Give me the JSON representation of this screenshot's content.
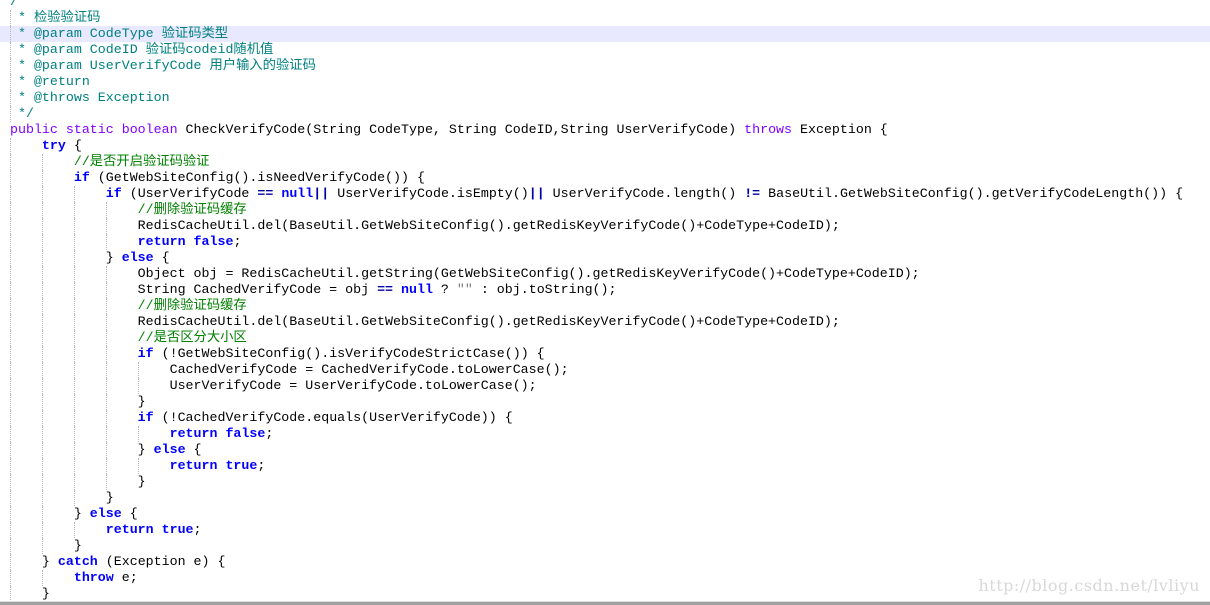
{
  "colors": {
    "javadoc": "#008080",
    "comment": "#008000",
    "keyword": "#0000ff",
    "modifier": "#8000ff",
    "highlight": "#e8e8ff"
  },
  "highlighted_line": 3,
  "watermark": "http://blog.csdn.net/lvliyu",
  "lines": [
    [
      [
        "c",
        "/**"
      ]
    ],
    [
      [
        "c",
        " * 检验验证码"
      ]
    ],
    [
      [
        "c",
        " * @param CodeType 验证码类型"
      ]
    ],
    [
      [
        "c",
        " * @param CodeID 验证码codeid随机值"
      ]
    ],
    [
      [
        "c",
        " * @param UserVerifyCode 用户输入的验证码"
      ]
    ],
    [
      [
        "c",
        " * @return"
      ]
    ],
    [
      [
        "c",
        " * @throws Exception"
      ]
    ],
    [
      [
        "c",
        " */"
      ]
    ],
    [
      [
        "kp",
        "public static boolean"
      ],
      [
        "t",
        " CheckVerifyCode(String CodeType, String CodeID,String UserVerifyCode) "
      ],
      [
        "kp",
        "throws"
      ],
      [
        "t",
        " Exception {"
      ]
    ],
    [
      [
        "t",
        "    "
      ],
      [
        "k",
        "try"
      ],
      [
        "t",
        " {"
      ]
    ],
    [
      [
        "t",
        "        "
      ],
      [
        "cm",
        "//是否开启验证码验证"
      ]
    ],
    [
      [
        "t",
        "        "
      ],
      [
        "k",
        "if"
      ],
      [
        "t",
        " (GetWebSiteConfig().isNeedVerifyCode()) {"
      ]
    ],
    [
      [
        "t",
        "            "
      ],
      [
        "k",
        "if"
      ],
      [
        "t",
        " (UserVerifyCode "
      ],
      [
        "o",
        "=="
      ],
      [
        "t",
        " "
      ],
      [
        "k",
        "null"
      ],
      [
        "o",
        "||"
      ],
      [
        "t",
        " UserVerifyCode.isEmpty()"
      ],
      [
        "o",
        "||"
      ],
      [
        "t",
        " UserVerifyCode.length() "
      ],
      [
        "o",
        "!="
      ],
      [
        "t",
        " BaseUtil.GetWebSiteConfig().getVerifyCodeLength()) {"
      ]
    ],
    [
      [
        "t",
        "                "
      ],
      [
        "cm",
        "//删除验证码缓存"
      ]
    ],
    [
      [
        "t",
        "                RedisCacheUtil.del(BaseUtil.GetWebSiteConfig().getRedisKeyVerifyCode()+CodeType+CodeID);"
      ]
    ],
    [
      [
        "t",
        "                "
      ],
      [
        "k",
        "return false"
      ],
      [
        "t",
        ";"
      ]
    ],
    [
      [
        "t",
        "            } "
      ],
      [
        "k",
        "else"
      ],
      [
        "t",
        " {"
      ]
    ],
    [
      [
        "t",
        "                Object obj = RedisCacheUtil.getString(GetWebSiteConfig().getRedisKeyVerifyCode()+CodeType+CodeID);"
      ]
    ],
    [
      [
        "t",
        "                String CachedVerifyCode = obj "
      ],
      [
        "o",
        "=="
      ],
      [
        "t",
        " "
      ],
      [
        "k",
        "null"
      ],
      [
        "t",
        " ? "
      ],
      [
        "s",
        "\"\""
      ],
      [
        "t",
        " : obj.toString();"
      ]
    ],
    [
      [
        "t",
        "                "
      ],
      [
        "cm",
        "//删除验证码缓存"
      ]
    ],
    [
      [
        "t",
        "                RedisCacheUtil.del(BaseUtil.GetWebSiteConfig().getRedisKeyVerifyCode()+CodeType+CodeID);"
      ]
    ],
    [
      [
        "t",
        "                "
      ],
      [
        "cm",
        "//是否区分大小区"
      ]
    ],
    [
      [
        "t",
        "                "
      ],
      [
        "k",
        "if"
      ],
      [
        "t",
        " (!GetWebSiteConfig().isVerifyCodeStrictCase()) {"
      ]
    ],
    [
      [
        "t",
        "                    CachedVerifyCode = CachedVerifyCode.toLowerCase();"
      ]
    ],
    [
      [
        "t",
        "                    UserVerifyCode = UserVerifyCode.toLowerCase();"
      ]
    ],
    [
      [
        "t",
        "                }"
      ]
    ],
    [
      [
        "t",
        "                "
      ],
      [
        "k",
        "if"
      ],
      [
        "t",
        " (!CachedVerifyCode.equals(UserVerifyCode)) {"
      ]
    ],
    [
      [
        "t",
        "                    "
      ],
      [
        "k",
        "return false"
      ],
      [
        "t",
        ";"
      ]
    ],
    [
      [
        "t",
        "                } "
      ],
      [
        "k",
        "else"
      ],
      [
        "t",
        " {"
      ]
    ],
    [
      [
        "t",
        "                    "
      ],
      [
        "k",
        "return true"
      ],
      [
        "t",
        ";"
      ]
    ],
    [
      [
        "t",
        "                }"
      ]
    ],
    [
      [
        "t",
        "            }"
      ]
    ],
    [
      [
        "t",
        "        } "
      ],
      [
        "k",
        "else"
      ],
      [
        "t",
        " {"
      ]
    ],
    [
      [
        "t",
        "            "
      ],
      [
        "k",
        "return true"
      ],
      [
        "t",
        ";"
      ]
    ],
    [
      [
        "t",
        "        }"
      ]
    ],
    [
      [
        "t",
        "    } "
      ],
      [
        "k",
        "catch"
      ],
      [
        "t",
        " (Exception e) {"
      ]
    ],
    [
      [
        "t",
        "        "
      ],
      [
        "k",
        "throw"
      ],
      [
        "t",
        " e;"
      ]
    ],
    [
      [
        "t",
        "    }"
      ]
    ]
  ]
}
